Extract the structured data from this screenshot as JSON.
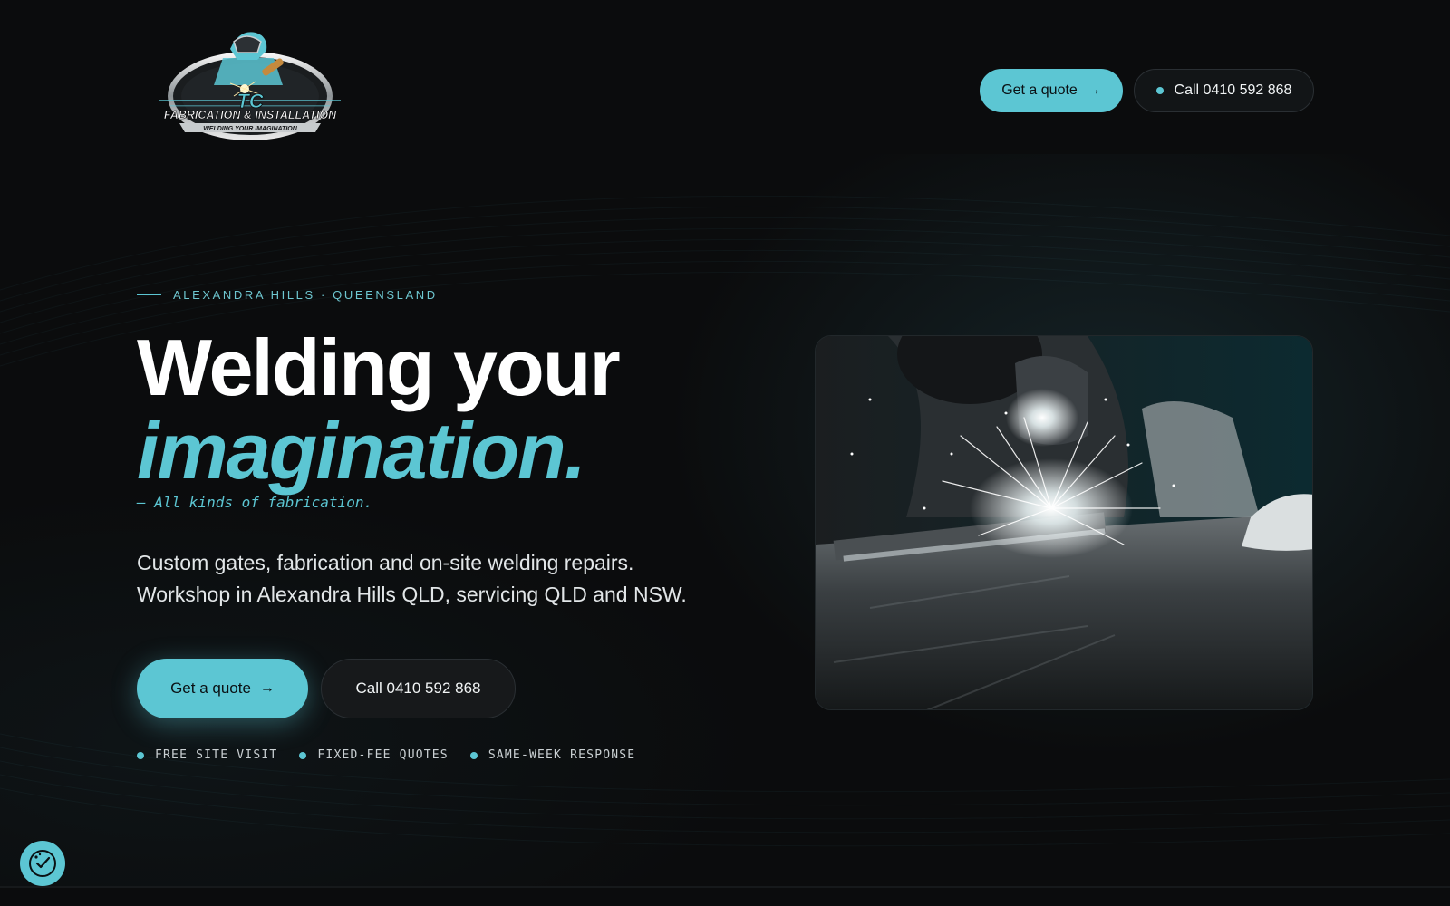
{
  "header": {
    "logo": {
      "initials": "TC",
      "company": "FABRICATION & INSTALLATION",
      "motto": "WELDING YOUR IMAGINATION"
    },
    "quote_label": "Get a quote",
    "call_label": "Call 0410 592 868"
  },
  "hero": {
    "kicker": "ALEXANDRA HILLS · QUEENSLAND",
    "headline_line1": "Welding your",
    "headline_line2": "imagination.",
    "tagline": "— All kinds of fabrication.",
    "lede_line1": "Custom gates, fabrication and on-site welding repairs.",
    "lede_line2": "Workshop in Alexandra Hills QLD, servicing QLD and NSW.",
    "primary_cta": "Get a quote",
    "secondary_cta": "Call 0410 592 868",
    "badges": [
      "FREE SITE VISIT",
      "FIXED-FEE QUOTES",
      "SAME-WEEK RESPONSE"
    ]
  },
  "icons": {
    "arrow": "arrow-right-icon",
    "status_dot": "dot-icon",
    "floating": "cookie-consent-icon"
  },
  "colors": {
    "background": "#0b0c0d",
    "accent": "#5cc6d3",
    "text": "#ffffff"
  }
}
